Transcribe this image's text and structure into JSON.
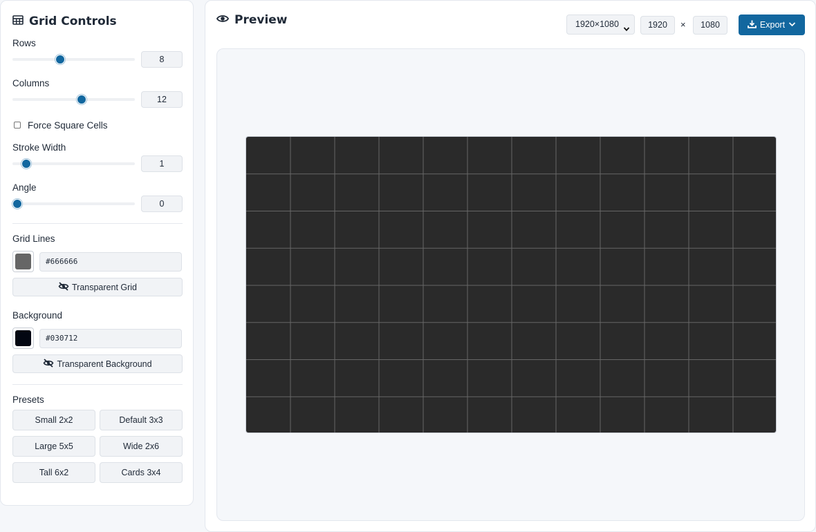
{
  "sidebar": {
    "title": "Grid Controls",
    "rows": {
      "label": "Rows",
      "value": "8",
      "fraction": 0.38
    },
    "columns": {
      "label": "Columns",
      "value": "12",
      "fraction": 0.57
    },
    "force_square": {
      "label": "Force Square Cells",
      "checked": false
    },
    "stroke_width": {
      "label": "Stroke Width",
      "value": "1",
      "fraction": 0.08
    },
    "angle": {
      "label": "Angle",
      "value": "0",
      "fraction": 0.0
    },
    "grid_lines": {
      "label": "Grid Lines",
      "color": "#666666",
      "hex": "#666666",
      "transparent_label": "Transparent Grid"
    },
    "background": {
      "label": "Background",
      "color": "#030712",
      "hex": "#030712",
      "transparent_label": "Transparent Background"
    },
    "presets": {
      "label": "Presets",
      "items": [
        "Small 2x2",
        "Default 3x3",
        "Large 5x5",
        "Wide 2x6",
        "Tall 6x2",
        "Cards 3x4"
      ]
    }
  },
  "main": {
    "title": "Preview",
    "size_option": "1920×1080",
    "width": "1920",
    "times": "×",
    "height": "1080",
    "export_label": "Export"
  },
  "preview": {
    "rows": 8,
    "columns": 12,
    "fill_color": "#2a2a2a",
    "line_color": "#666666"
  },
  "icons": {
    "title_icon": "table-icon",
    "preview_icon": "eye-icon",
    "transparent_icon": "eye-slash-icon",
    "export_icon": "download-icon",
    "export_chevron": "chevron-down-icon"
  }
}
